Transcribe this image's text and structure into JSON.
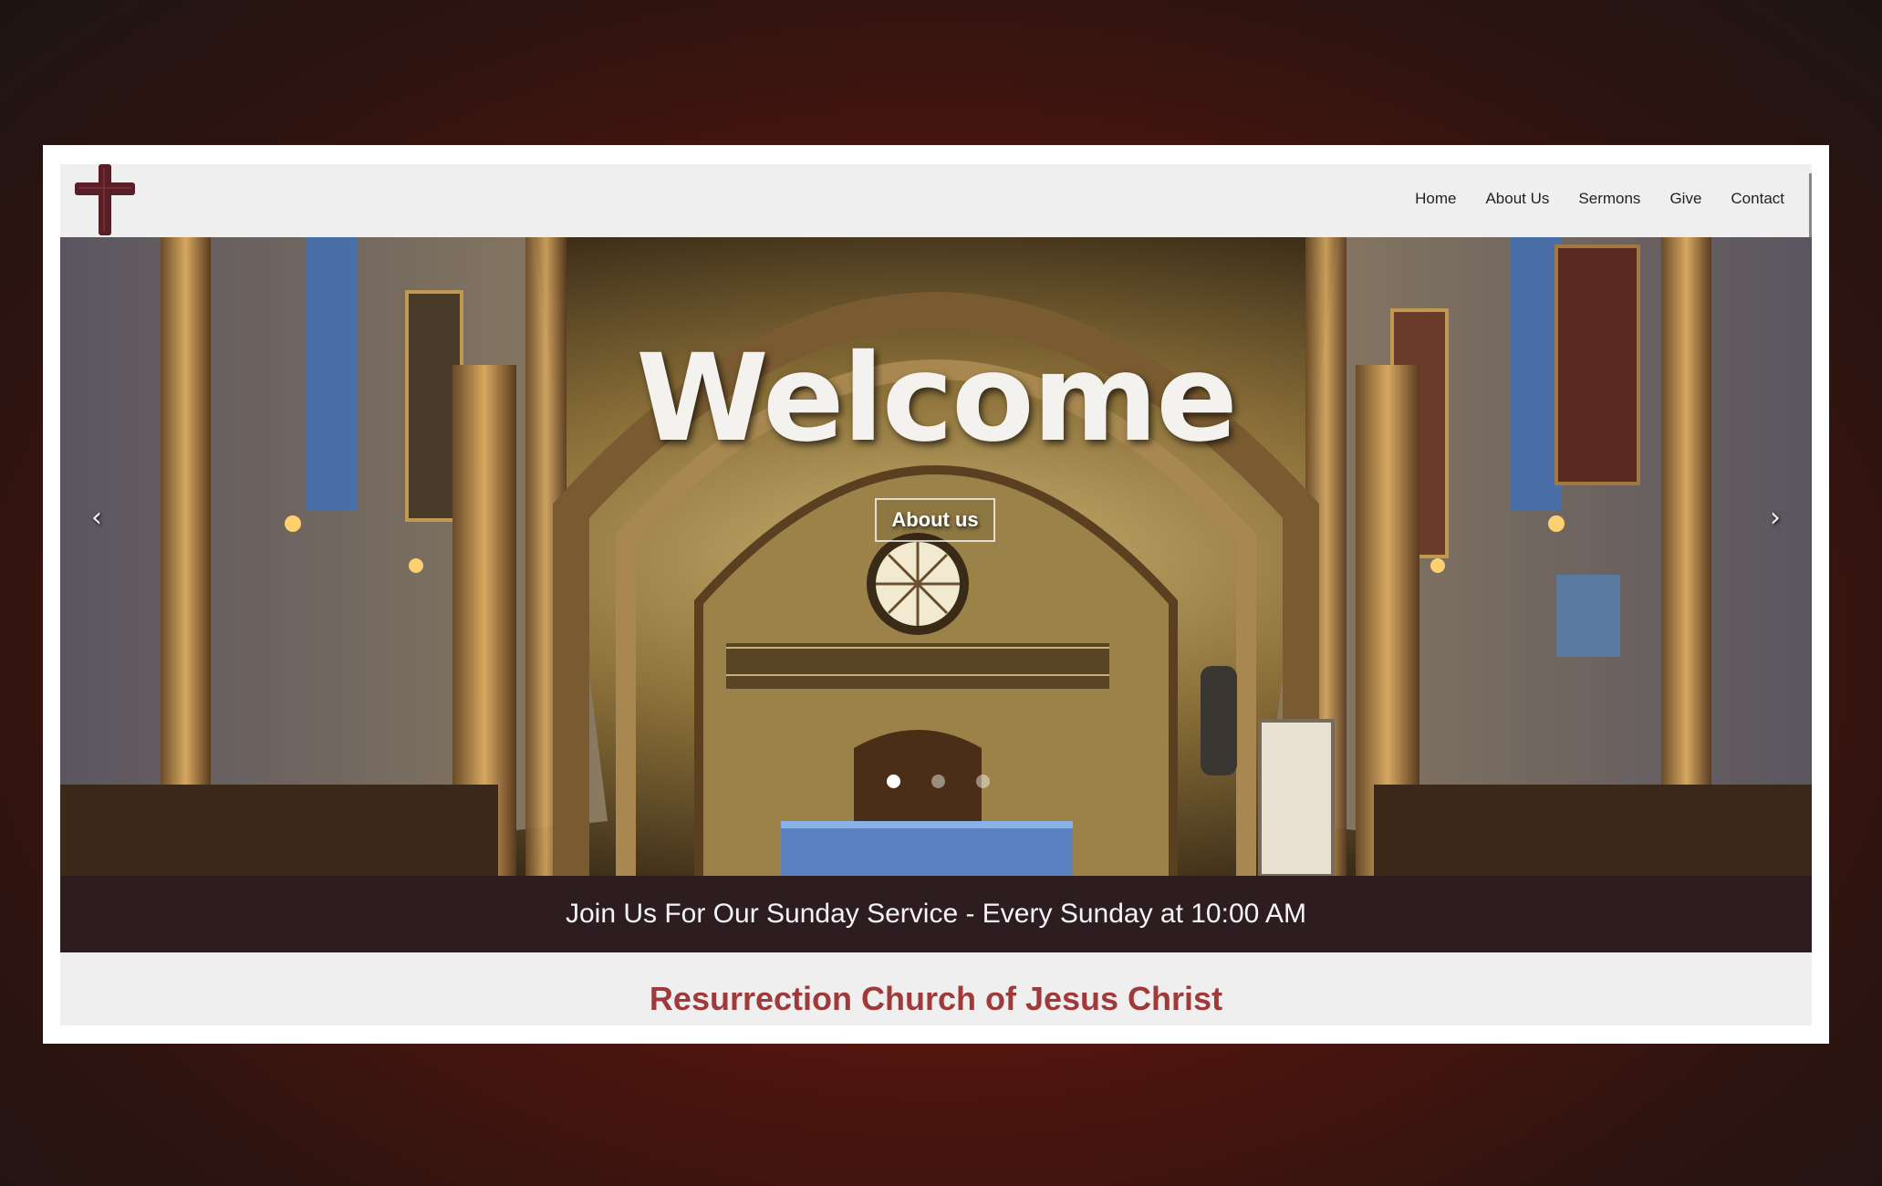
{
  "nav": {
    "logo_icon": "cross-icon",
    "links": [
      "Home",
      "About Us",
      "Sermons",
      "Give",
      "Contact"
    ]
  },
  "hero": {
    "title": "Welcome",
    "button_label": "About us",
    "prev_label": "‹",
    "next_label": "›",
    "slide_count": 3,
    "active_slide": 1
  },
  "service_banner": "Join Us For Our Sunday Service - Every Sunday at 10:00 AM",
  "church_name": "Resurrection Church of Jesus Christ",
  "colors": {
    "accent": "#a03a3a",
    "banner_bg": "#2d1c20",
    "logo": "#5a1e26",
    "page_bg": "#5a150d"
  }
}
